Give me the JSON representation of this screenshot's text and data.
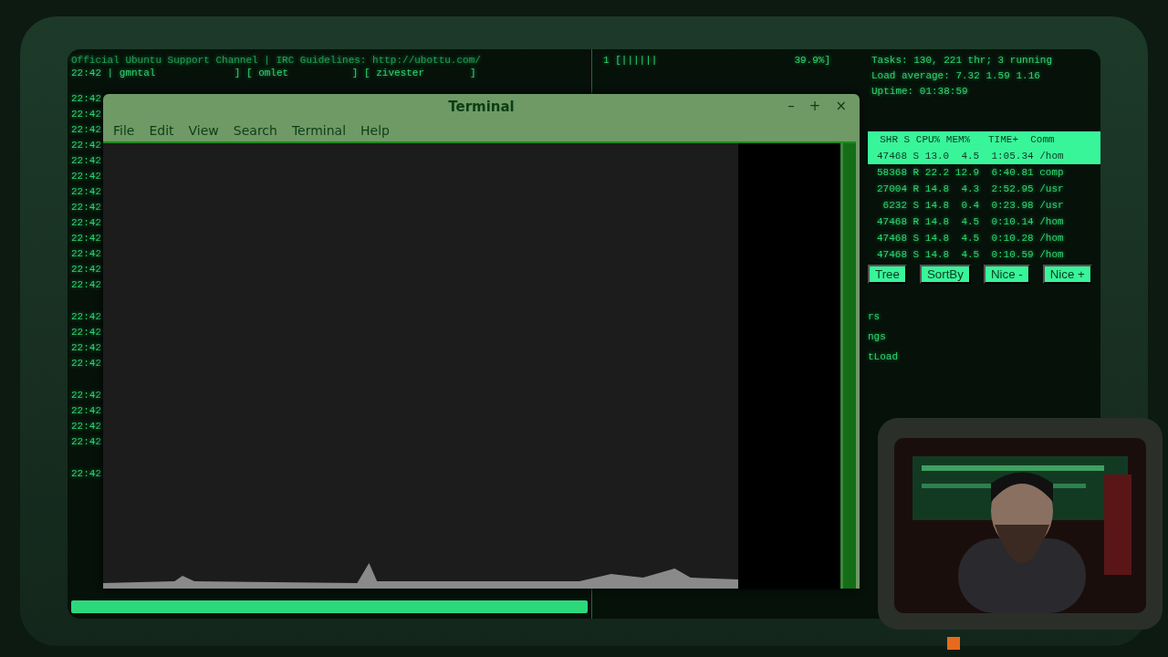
{
  "irc": {
    "topic": "Official Ubuntu Support Channel | IRC Guidelines: http://ubottu.com/",
    "nicks": [
      "22:42 | gmntal",
      "] [ omlet",
      "] [ zivester",
      "]"
    ],
    "timestamps": [
      [
        "22:42",
        "22:42",
        "22:42",
        "22:42",
        "22:42",
        "22:42",
        "22:42",
        "22:42",
        "22:42",
        "22:42",
        "22:42",
        "22:42",
        "22:42"
      ],
      [
        "22:42",
        "22:42",
        "22:42",
        "22:42"
      ],
      [
        "22:42",
        "22:42",
        "22:42",
        "22:42"
      ],
      [
        "22:42"
      ]
    ]
  },
  "htop": {
    "cpu_meter": "1  [||||||",
    "cpu_reading": "39.9%]",
    "stats": [
      "Tasks: 130, 221 thr; 3 running",
      "Load average: 7.32 1.59 1.16",
      "Uptime: 01:38:59"
    ],
    "header": "  SHR S CPU% MEM%   TIME+  Comm",
    "rows": [
      {
        "text": "47468 S 13.0  4.5  1:05.34 /hom",
        "selected": true
      },
      {
        "text": "58368 R 22.2 12.9  6:40.81 comp",
        "selected": false
      },
      {
        "text": "27004 R 14.8  4.3  2:52.95 /usr",
        "selected": false
      },
      {
        "text": " 6232 S 14.8  0.4  0:23.98 /usr",
        "selected": false
      },
      {
        "text": "47468 R 14.8  4.5  0:10.14 /hom",
        "selected": false
      },
      {
        "text": "47468 S 14.8  4.5  0:10.28 /hom",
        "selected": false
      },
      {
        "text": "47468 S 14.8  4.5  0:10.59 /hom",
        "selected": false
      }
    ],
    "function_keys": [
      "Tree",
      "SortBy",
      "Nice -",
      "Nice +"
    ],
    "lower_lines": [
      "rs",
      "ngs",
      "tLoad"
    ]
  },
  "terminal": {
    "title": "Terminal",
    "window_buttons": [
      "–",
      "+",
      "×"
    ],
    "menu": [
      "File",
      "Edit",
      "View",
      "Search",
      "Terminal",
      "Help"
    ]
  }
}
